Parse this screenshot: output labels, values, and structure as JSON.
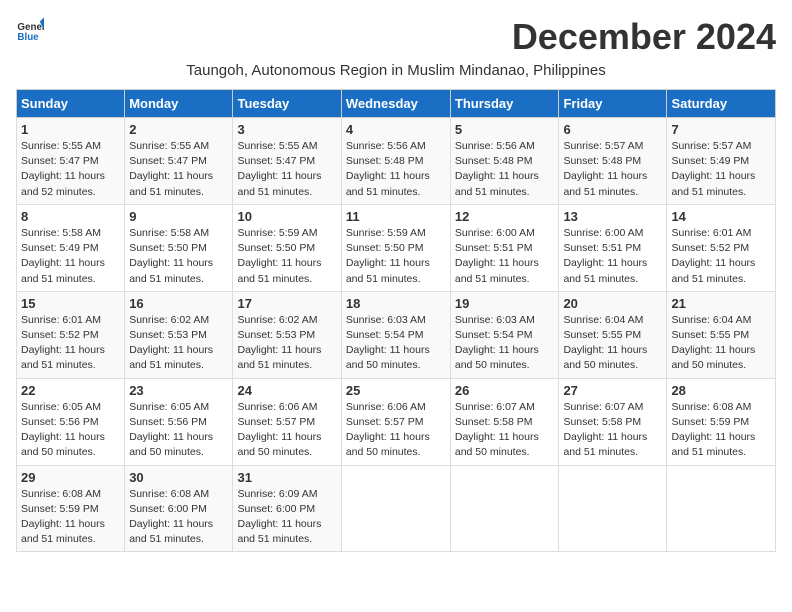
{
  "logo": {
    "general": "General",
    "blue": "Blue"
  },
  "title": "December 2024",
  "subtitle": "Taungoh, Autonomous Region in Muslim Mindanao, Philippines",
  "days_of_week": [
    "Sunday",
    "Monday",
    "Tuesday",
    "Wednesday",
    "Thursday",
    "Friday",
    "Saturday"
  ],
  "weeks": [
    [
      {
        "day": "1",
        "sunrise": "5:55 AM",
        "sunset": "5:47 PM",
        "daylight": "11 hours and 52 minutes."
      },
      {
        "day": "2",
        "sunrise": "5:55 AM",
        "sunset": "5:47 PM",
        "daylight": "11 hours and 51 minutes."
      },
      {
        "day": "3",
        "sunrise": "5:55 AM",
        "sunset": "5:47 PM",
        "daylight": "11 hours and 51 minutes."
      },
      {
        "day": "4",
        "sunrise": "5:56 AM",
        "sunset": "5:48 PM",
        "daylight": "11 hours and 51 minutes."
      },
      {
        "day": "5",
        "sunrise": "5:56 AM",
        "sunset": "5:48 PM",
        "daylight": "11 hours and 51 minutes."
      },
      {
        "day": "6",
        "sunrise": "5:57 AM",
        "sunset": "5:48 PM",
        "daylight": "11 hours and 51 minutes."
      },
      {
        "day": "7",
        "sunrise": "5:57 AM",
        "sunset": "5:49 PM",
        "daylight": "11 hours and 51 minutes."
      }
    ],
    [
      {
        "day": "8",
        "sunrise": "5:58 AM",
        "sunset": "5:49 PM",
        "daylight": "11 hours and 51 minutes."
      },
      {
        "day": "9",
        "sunrise": "5:58 AM",
        "sunset": "5:50 PM",
        "daylight": "11 hours and 51 minutes."
      },
      {
        "day": "10",
        "sunrise": "5:59 AM",
        "sunset": "5:50 PM",
        "daylight": "11 hours and 51 minutes."
      },
      {
        "day": "11",
        "sunrise": "5:59 AM",
        "sunset": "5:50 PM",
        "daylight": "11 hours and 51 minutes."
      },
      {
        "day": "12",
        "sunrise": "6:00 AM",
        "sunset": "5:51 PM",
        "daylight": "11 hours and 51 minutes."
      },
      {
        "day": "13",
        "sunrise": "6:00 AM",
        "sunset": "5:51 PM",
        "daylight": "11 hours and 51 minutes."
      },
      {
        "day": "14",
        "sunrise": "6:01 AM",
        "sunset": "5:52 PM",
        "daylight": "11 hours and 51 minutes."
      }
    ],
    [
      {
        "day": "15",
        "sunrise": "6:01 AM",
        "sunset": "5:52 PM",
        "daylight": "11 hours and 51 minutes."
      },
      {
        "day": "16",
        "sunrise": "6:02 AM",
        "sunset": "5:53 PM",
        "daylight": "11 hours and 51 minutes."
      },
      {
        "day": "17",
        "sunrise": "6:02 AM",
        "sunset": "5:53 PM",
        "daylight": "11 hours and 51 minutes."
      },
      {
        "day": "18",
        "sunrise": "6:03 AM",
        "sunset": "5:54 PM",
        "daylight": "11 hours and 50 minutes."
      },
      {
        "day": "19",
        "sunrise": "6:03 AM",
        "sunset": "5:54 PM",
        "daylight": "11 hours and 50 minutes."
      },
      {
        "day": "20",
        "sunrise": "6:04 AM",
        "sunset": "5:55 PM",
        "daylight": "11 hours and 50 minutes."
      },
      {
        "day": "21",
        "sunrise": "6:04 AM",
        "sunset": "5:55 PM",
        "daylight": "11 hours and 50 minutes."
      }
    ],
    [
      {
        "day": "22",
        "sunrise": "6:05 AM",
        "sunset": "5:56 PM",
        "daylight": "11 hours and 50 minutes."
      },
      {
        "day": "23",
        "sunrise": "6:05 AM",
        "sunset": "5:56 PM",
        "daylight": "11 hours and 50 minutes."
      },
      {
        "day": "24",
        "sunrise": "6:06 AM",
        "sunset": "5:57 PM",
        "daylight": "11 hours and 50 minutes."
      },
      {
        "day": "25",
        "sunrise": "6:06 AM",
        "sunset": "5:57 PM",
        "daylight": "11 hours and 50 minutes."
      },
      {
        "day": "26",
        "sunrise": "6:07 AM",
        "sunset": "5:58 PM",
        "daylight": "11 hours and 50 minutes."
      },
      {
        "day": "27",
        "sunrise": "6:07 AM",
        "sunset": "5:58 PM",
        "daylight": "11 hours and 51 minutes."
      },
      {
        "day": "28",
        "sunrise": "6:08 AM",
        "sunset": "5:59 PM",
        "daylight": "11 hours and 51 minutes."
      }
    ],
    [
      {
        "day": "29",
        "sunrise": "6:08 AM",
        "sunset": "5:59 PM",
        "daylight": "11 hours and 51 minutes."
      },
      {
        "day": "30",
        "sunrise": "6:08 AM",
        "sunset": "6:00 PM",
        "daylight": "11 hours and 51 minutes."
      },
      {
        "day": "31",
        "sunrise": "6:09 AM",
        "sunset": "6:00 PM",
        "daylight": "11 hours and 51 minutes."
      },
      null,
      null,
      null,
      null
    ]
  ]
}
